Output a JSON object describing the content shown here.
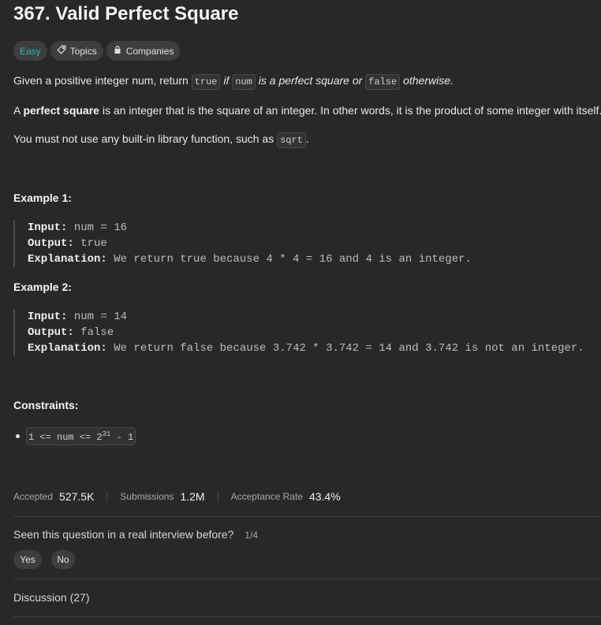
{
  "problem": {
    "title": "367. Valid Perfect Square",
    "difficulty": "Easy",
    "topics_label": "Topics",
    "companies_label": "Companies"
  },
  "description": {
    "line1_a": "Given a positive integer num, return ",
    "line1_code1": "true",
    "line1_b": " if ",
    "line1_code2": "num",
    "line1_c": " is a perfect square or ",
    "line1_code3": "false",
    "line1_d": " otherwise.",
    "line2_a": "A ",
    "line2_bold": "perfect square",
    "line2_b": " is an integer that is the square of an integer. In other words, it is the product of some integer with itself.",
    "line3_a": "You must not use any built-in library function, such as ",
    "line3_code": "sqrt",
    "line3_b": "."
  },
  "examples": [
    {
      "heading": "Example 1:",
      "input_label": "Input:",
      "input_value": " num = 16",
      "output_label": "Output:",
      "output_value": " true",
      "explanation_label": "Explanation:",
      "explanation_value": " We return true because 4 * 4 = 16 and 4 is an integer."
    },
    {
      "heading": "Example 2:",
      "input_label": "Input:",
      "input_value": " num = 14",
      "output_label": "Output:",
      "output_value": " false",
      "explanation_label": "Explanation:",
      "explanation_value": " We return false because 3.742 * 3.742 = 14 and 3.742 is not an integer."
    }
  ],
  "constraints": {
    "heading": "Constraints:",
    "item_a": "1 <= num <= 2",
    "item_sup": "31",
    "item_b": " - 1"
  },
  "stats": {
    "accepted_label": "Accepted",
    "accepted_value": "527.5K",
    "submissions_label": "Submissions",
    "submissions_value": "1.2M",
    "rate_label": "Acceptance Rate",
    "rate_value": "43.4%"
  },
  "interview": {
    "question": "Seen this question in a real interview before?",
    "count": "1/4",
    "yes_label": "Yes",
    "no_label": "No"
  },
  "discussion": {
    "label": "Discussion (27)"
  },
  "icons": {
    "topics": "tag-icon",
    "companies": "lock-icon"
  },
  "colors": {
    "background": "#282828",
    "easy": "#2cbbb3",
    "chip": "#3e3e3e"
  }
}
